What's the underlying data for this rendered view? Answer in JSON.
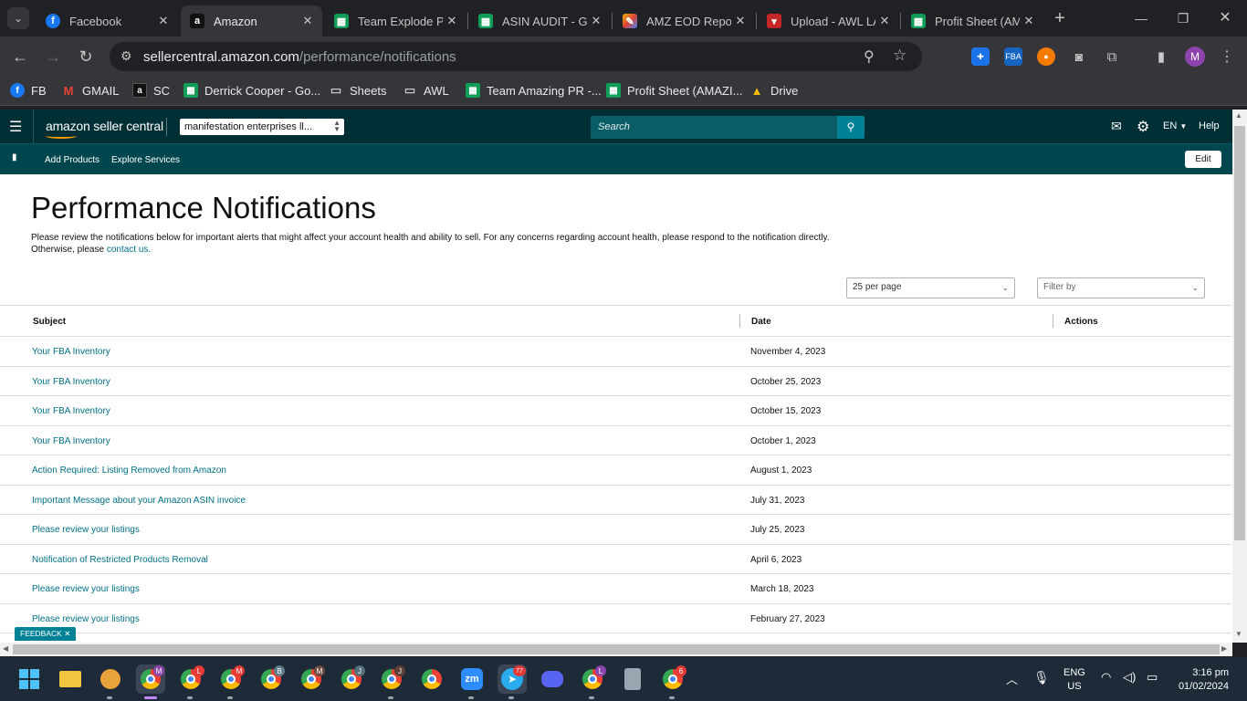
{
  "browser": {
    "tabs": [
      {
        "label": "Facebook",
        "icon": "facebook-icon",
        "active": false
      },
      {
        "label": "Amazon",
        "icon": "amazon-icon",
        "active": true
      },
      {
        "label": "Team Explode PI",
        "icon": "sheets-icon",
        "active": false
      },
      {
        "label": "ASIN AUDIT - Go",
        "icon": "sheets-icon",
        "active": false
      },
      {
        "label": "AMZ EOD Repor",
        "icon": "eod-icon",
        "active": false
      },
      {
        "label": "Upload - AWL LA",
        "icon": "awl-icon",
        "active": false
      },
      {
        "label": "Profit Sheet (AM",
        "icon": "sheets-icon",
        "active": false
      }
    ],
    "url_host": "sellercentral.amazon.com",
    "url_path": "/performance/notifications",
    "bookmarks": [
      {
        "label": "FB",
        "icon": "facebook-icon"
      },
      {
        "label": "GMAIL",
        "icon": "gmail-icon"
      },
      {
        "label": "SC",
        "icon": "amazon-icon"
      },
      {
        "label": "Derrick Cooper - Go...",
        "icon": "sheets-icon"
      },
      {
        "label": "Sheets",
        "icon": "folder-icon"
      },
      {
        "label": "AWL",
        "icon": "folder-icon"
      },
      {
        "label": "Team Amazing PR -...",
        "icon": "sheets-icon"
      },
      {
        "label": "Profit Sheet (AMAZI...",
        "icon": "sheets-icon"
      },
      {
        "label": "Drive",
        "icon": "drive-icon"
      }
    ],
    "profile_initial": "M"
  },
  "header": {
    "logo_text": "amazon seller central",
    "account_selector": "manifestation enterprises ll...",
    "search_placeholder": "Search",
    "language": "EN",
    "help": "Help",
    "nav_links": [
      "Add Products",
      "Explore Services"
    ],
    "edit": "Edit"
  },
  "page": {
    "title": "Performance Notifications",
    "description": "Please review the notifications below for important alerts that might affect your account health and ability to sell. For any concerns regarding account health, please respond to the notification directly.",
    "description_line2_prefix": "Otherwise, please",
    "contact_link": "contact us.",
    "per_page": "25 per page",
    "filter_placeholder": "Filter by",
    "columns": [
      "Subject",
      "Date",
      "Actions"
    ],
    "rows": [
      {
        "subject": "Your FBA Inventory",
        "date": "November 4, 2023"
      },
      {
        "subject": "Your FBA Inventory",
        "date": "October 25, 2023"
      },
      {
        "subject": "Your FBA Inventory",
        "date": "October 15, 2023"
      },
      {
        "subject": "Your FBA Inventory",
        "date": "October 1, 2023"
      },
      {
        "subject": "Action Required: Listing Removed from Amazon",
        "date": "August 1, 2023"
      },
      {
        "subject": "Important Message about your Amazon ASIN invoice",
        "date": "July 31, 2023"
      },
      {
        "subject": "Please review your listings",
        "date": "July 25, 2023"
      },
      {
        "subject": "Notification of Restricted Products Removal",
        "date": "April 6, 2023"
      },
      {
        "subject": "Please review your listings",
        "date": "March 18, 2023"
      },
      {
        "subject": "Please review your listings",
        "date": "February 27, 2023"
      }
    ],
    "feedback": "FEEDBACK"
  },
  "taskbar": {
    "lang_top": "ENG",
    "lang_bottom": "US",
    "time": "3:16 pm",
    "date": "01/02/2024",
    "telegram_badge": "77",
    "badges": [
      "M",
      "L",
      "M",
      "B",
      "M",
      "J",
      "J",
      "L",
      "6"
    ]
  },
  "colors": {
    "amazon_header": "#002f36",
    "amazon_subnav": "#00464f",
    "link": "#007185",
    "search_button": "#008296"
  }
}
